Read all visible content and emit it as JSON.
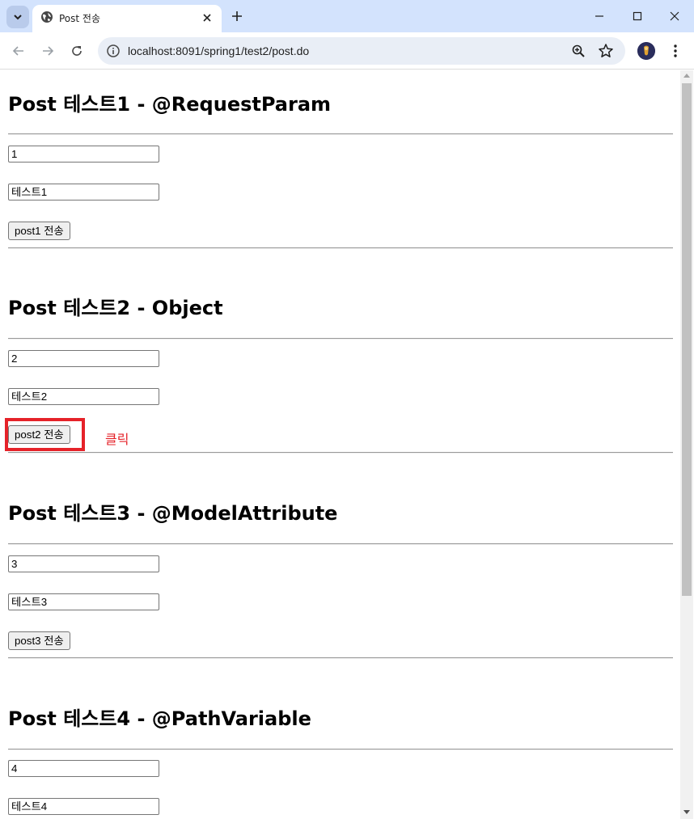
{
  "browser": {
    "tab_title": "Post 전송",
    "url": "localhost:8091/spring1/test2/post.do",
    "colors": {
      "chrome_bg": "#d3e3fd",
      "omnibox_bg": "#e9eef6"
    }
  },
  "sections": [
    {
      "heading": "Post 테스트1 - @RequestParam",
      "field1": "1",
      "field2": "테스트1",
      "button": "post1 전송"
    },
    {
      "heading": "Post 테스트2 - Object",
      "field1": "2",
      "field2": "테스트2",
      "button": "post2 전송"
    },
    {
      "heading": "Post 테스트3 - @ModelAttribute",
      "field1": "3",
      "field2": "테스트3",
      "button": "post3 전송"
    },
    {
      "heading": "Post 테스트4 - @PathVariable",
      "field1": "4",
      "field2": "테스트4"
    }
  ],
  "annotation": {
    "text": "클릭",
    "color": "#e52229"
  }
}
